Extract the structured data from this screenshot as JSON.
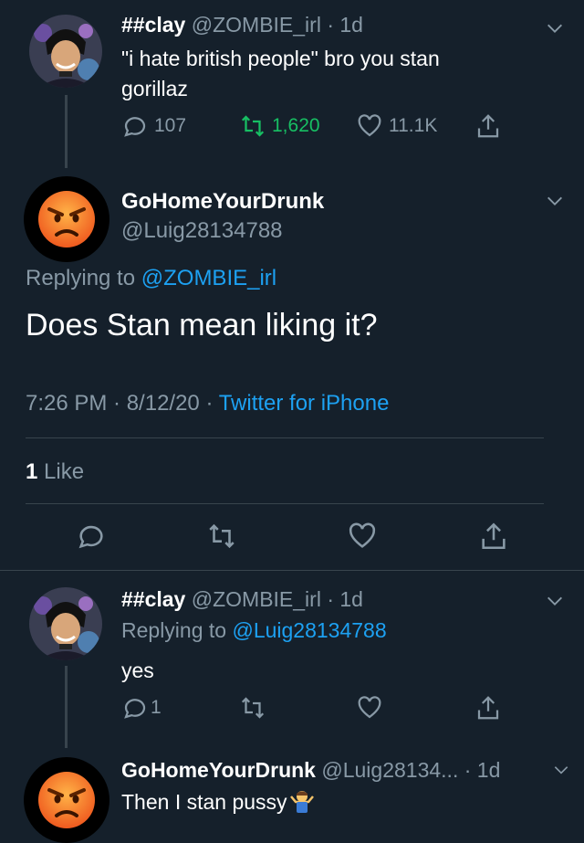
{
  "tweet1": {
    "display_name": "##clay",
    "handle": "@ZOMBIE_irl",
    "time": "· 1d",
    "text_line1": "\"i hate british people\" bro you stan",
    "text_line2": "gorillaz",
    "replies": "107",
    "retweets": "1,620",
    "likes": "11.1K"
  },
  "main": {
    "display_name": "GoHomeYourDrunk",
    "handle": "@Luig28134788",
    "replying_label": "Replying to",
    "replying_handle": "@ZOMBIE_irl",
    "text": "Does Stan mean liking it?",
    "timestamp": "7:26 PM · 8/12/20 ·",
    "source": "Twitter for iPhone",
    "like_count": "1",
    "like_label": "Like"
  },
  "reply1": {
    "display_name": "##clay",
    "handle": "@ZOMBIE_irl",
    "time": "· 1d",
    "replying_label": "Replying to",
    "replying_handle": "@Luig28134788",
    "text": "yes",
    "replies": "1"
  },
  "reply2": {
    "display_name": "GoHomeYourDrunk",
    "handle": "@Luig28134...",
    "time": "· 1d",
    "text": "Then I stan pussy"
  },
  "colors": {
    "background": "#15202b",
    "muted": "#8899a6",
    "link": "#1da1f2",
    "retweet_active": "#17bf63",
    "divider": "#38444d"
  }
}
